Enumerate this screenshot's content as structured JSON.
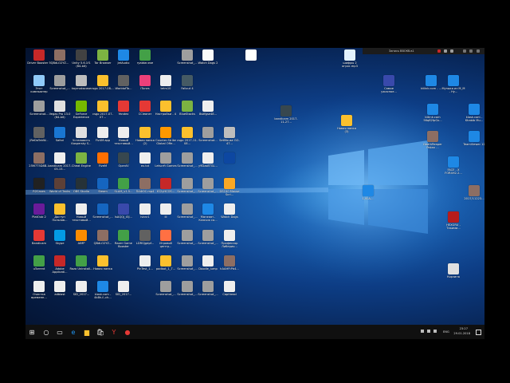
{
  "desktop_icons": [
    {
      "label": "Driver Booster 5",
      "color": "#c62828",
      "col": 0,
      "row": 0
    },
    {
      "label": "QBdLO2YZ...",
      "color": "#8d6e63",
      "col": 1,
      "row": 0
    },
    {
      "label": "Unity 5.6.1f1 (64-bit)",
      "color": "#424242",
      "col": 2,
      "row": 0
    },
    {
      "label": "Tor Browser",
      "color": "#7cb342",
      "col": 3,
      "row": 0
    },
    {
      "label": "JetAudio",
      "color": "#1e88e5",
      "col": 4,
      "row": 0
    },
    {
      "label": "ryabtar.exe",
      "color": "#43a047",
      "col": 5,
      "row": 0
    },
    {
      "label": "Screenshot_...",
      "color": "#9e9e9e",
      "col": 7,
      "row": 0
    },
    {
      "label": "Watch Dogs 2",
      "color": "#fafafa",
      "col": 8,
      "row": 0
    },
    {
      "label": "",
      "color": "#ffffff",
      "col": 10,
      "row": 0
    },
    {
      "label": "Этот компьютер",
      "color": "#90caf9",
      "col": 0,
      "row": 1
    },
    {
      "label": "Screenshot_...",
      "color": "#9e9e9e",
      "col": 1,
      "row": 1
    },
    {
      "label": "kaymakacase",
      "color": "#bdbdbd",
      "col": 2,
      "row": 1
    },
    {
      "label": "csgo 2017-08-...",
      "color": "#fbc02d",
      "col": 3,
      "row": 1
    },
    {
      "label": "WorldofTa...",
      "color": "#616161",
      "col": 4,
      "row": 1
    },
    {
      "label": "iTunes",
      "color": "#ec407a",
      "col": 5,
      "row": 1
    },
    {
      "label": "tetrs10",
      "color": "#eeeeee",
      "col": 6,
      "row": 1
    },
    {
      "label": "Fallout 4",
      "color": "#455a64",
      "col": 7,
      "row": 1
    },
    {
      "label": "Screenshot...",
      "color": "#9e9e9e",
      "col": 0,
      "row": 2
    },
    {
      "label": "Vegas Pro 13.0 (64-bit)",
      "color": "#e0e0e0",
      "col": 1,
      "row": 2
    },
    {
      "label": "GeForce Experience",
      "color": "#76b900",
      "col": 2,
      "row": 2
    },
    {
      "label": "csgo 2017-07-07...",
      "color": "#fbc02d",
      "col": 3,
      "row": 2
    },
    {
      "label": "Yandex",
      "color": "#e53935",
      "col": 4,
      "row": 2
    },
    {
      "label": "CCleaner",
      "color": "#e53935",
      "col": 5,
      "row": 2
    },
    {
      "label": "Настройки - 4",
      "color": "#fbc02d",
      "col": 6,
      "row": 2
    },
    {
      "label": "BlueStacks",
      "color": "#7cb342",
      "col": 7,
      "row": 2
    },
    {
      "label": "8sdfgse48...",
      "color": "#eeeeee",
      "col": 8,
      "row": 2
    },
    {
      "label": "jReDoTahW...",
      "color": "#616161",
      "col": 0,
      "row": 3
    },
    {
      "label": "Safari",
      "color": "#1976d2",
      "col": 1,
      "row": 3
    },
    {
      "label": "Установить Kaspersky S...",
      "color": "#e0e0e0",
      "col": 2,
      "row": 3
    },
    {
      "label": "Fiv4M.app",
      "color": "#eeeeee",
      "col": 3,
      "row": 3
    },
    {
      "label": "Новый текстовый...",
      "color": "#eeeeee",
      "col": 4,
      "row": 3
    },
    {
      "label": "Новая папка (2)",
      "color": "#fbc02d",
      "col": 5,
      "row": 3
    },
    {
      "label": "Counter-Strike Global Offe...",
      "color": "#ff9800",
      "col": 6,
      "row": 3
    },
    {
      "label": "csgo 2017-11-08...",
      "color": "#fbc02d",
      "col": 7,
      "row": 3
    },
    {
      "label": "Screenshot...",
      "color": "#9e9e9e",
      "col": 8,
      "row": 3
    },
    {
      "label": "SetMouse GO-47...",
      "color": "#bdbdbd",
      "col": 9,
      "row": 3
    },
    {
      "label": "25M7T5D8B...",
      "color": "#8d6e63",
      "col": 0,
      "row": 4
    },
    {
      "label": "bandicam 2017-05-15...",
      "color": "#eeeeee",
      "col": 1,
      "row": 4
    },
    {
      "label": "Cheat Engine",
      "color": "#7cb342",
      "col": 2,
      "row": 4
    },
    {
      "label": "FiveM",
      "color": "#ff6f00",
      "col": 3,
      "row": 4
    },
    {
      "label": "OpenIV",
      "color": "#37474f",
      "col": 4,
      "row": 4
    },
    {
      "label": "ex.txt",
      "color": "#eeeeee",
      "col": 5,
      "row": 4
    },
    {
      "label": "Letscrft Games",
      "color": "#9e9e9e",
      "col": 6,
      "row": 4
    },
    {
      "label": "Screenshot_...",
      "color": "#9e9e9e",
      "col": 7,
      "row": 4
    },
    {
      "label": "y9Dzo8TGL...",
      "color": "#eeeeee",
      "col": 8,
      "row": 4
    },
    {
      "label": "",
      "color": "#0d47a1",
      "col": 9,
      "row": 4
    },
    {
      "label": "R2Cases",
      "color": "#212121",
      "col": 0,
      "row": 5
    },
    {
      "label": "World of Tanks",
      "color": "#5d4037",
      "col": 1,
      "row": 5
    },
    {
      "label": "OBS Studio",
      "color": "#263238",
      "col": 2,
      "row": 5
    },
    {
      "label": "Steam",
      "color": "#1565c0",
      "col": 3,
      "row": 5
    },
    {
      "label": "SLAM_v1.5...",
      "color": "#43a047",
      "col": 4,
      "row": 5
    },
    {
      "label": "ПАФОС.mp4",
      "color": "#8d6e63",
      "col": 5,
      "row": 5
    },
    {
      "label": "fO2yHCOS...",
      "color": "#c62828",
      "col": 6,
      "row": 5
    },
    {
      "label": "Screenshot_...",
      "color": "#9e9e9e",
      "col": 7,
      "row": 5
    },
    {
      "label": "Screenshot_...",
      "color": "#9e9e9e",
      "col": 8,
      "row": 5
    },
    {
      "label": "DSC40 Mouse Scri...",
      "color": "#f9a825",
      "col": 9,
      "row": 5
    },
    {
      "label": "PlatOub 2",
      "color": "#6a1b9a",
      "col": 0,
      "row": 6
    },
    {
      "label": "Доступ Пользов...",
      "color": "#fbc02d",
      "col": 1,
      "row": 6
    },
    {
      "label": "Новый текстовый...",
      "color": "#eeeeee",
      "col": 2,
      "row": 6
    },
    {
      "label": "Screenshot_...",
      "color": "#1565c0",
      "col": 3,
      "row": 6
    },
    {
      "label": "lsAQQj_t3J...",
      "color": "#3949ab",
      "col": 4,
      "row": 6
    },
    {
      "label": "lvbnr1",
      "color": "#eeeeee",
      "col": 5,
      "row": 6
    },
    {
      "label": "lll",
      "color": "#eeeeee",
      "col": 6,
      "row": 6
    },
    {
      "label": "Screenshot_...",
      "color": "#9e9e9e",
      "col": 7,
      "row": 6
    },
    {
      "label": "Магазин - Ключик со...",
      "color": "#1e88e5",
      "col": 8,
      "row": 6
    },
    {
      "label": "Watch Dogs",
      "color": "#eeeeee",
      "col": 9,
      "row": 6
    },
    {
      "label": "Bandicam",
      "color": "#e53935",
      "col": 0,
      "row": 7
    },
    {
      "label": "Skype",
      "color": "#039be5",
      "col": 1,
      "row": 7
    },
    {
      "label": "AIMP",
      "color": "#fb8c00",
      "col": 2,
      "row": 7
    },
    {
      "label": "QBdLO2YZ...",
      "color": "#8d6e63",
      "col": 3,
      "row": 7
    },
    {
      "label": "Razer Game Booster",
      "color": "#43a047",
      "col": 4,
      "row": 7
    },
    {
      "label": "LDRGjgdpf...",
      "color": "#616161",
      "col": 5,
      "row": 7
    },
    {
      "label": "Игровой центр...",
      "color": "#ff7043",
      "col": 6,
      "row": 7
    },
    {
      "label": "Screenshot_...",
      "color": "#9e9e9e",
      "col": 7,
      "row": 7
    },
    {
      "label": "Screenshot_...",
      "color": "#9e9e9e",
      "col": 8,
      "row": 7
    },
    {
      "label": "Профессор Либерио...",
      "color": "#eeeeee",
      "col": 9,
      "row": 7
    },
    {
      "label": "uTorrent",
      "color": "#43a047",
      "col": 0,
      "row": 8
    },
    {
      "label": "Adobe Applicati...",
      "color": "#c62828",
      "col": 1,
      "row": 8
    },
    {
      "label": "Razo Uninstall...",
      "color": "#43a047",
      "col": 2,
      "row": 8
    },
    {
      "label": "Новая папка",
      "color": "#fbc02d",
      "col": 3,
      "row": 8
    },
    {
      "label": "PinTest_1...",
      "color": "#eeeeee",
      "col": 5,
      "row": 8
    },
    {
      "label": "podbot_1_7...",
      "color": "#fbc02d",
      "col": 6,
      "row": 8
    },
    {
      "label": "Screenshot_...",
      "color": "#9e9e9e",
      "col": 7,
      "row": 8
    },
    {
      "label": "Doodle_lump",
      "color": "#eeeeee",
      "col": 8,
      "row": 8
    },
    {
      "label": "hAAHFtPb4...",
      "color": "#8d6e63",
      "col": 9,
      "row": 8
    },
    {
      "label": "Очистка временн...",
      "color": "#eeeeee",
      "col": 0,
      "row": 9
    },
    {
      "label": "adblast",
      "color": "#eeeeee",
      "col": 1,
      "row": 9
    },
    {
      "label": "SID_2017...",
      "color": "#eeeeee",
      "col": 2,
      "row": 9
    },
    {
      "label": "kiosk.com - 4k8h-f--ch...",
      "color": "#1e88e5",
      "col": 3,
      "row": 9
    },
    {
      "label": "SID_2017...",
      "color": "#eeeeee",
      "col": 4,
      "row": 9
    },
    {
      "label": "Screenshot_...",
      "color": "#9e9e9e",
      "col": 6,
      "row": 9
    },
    {
      "label": "Screenshot_...",
      "color": "#9e9e9e",
      "col": 7,
      "row": 9
    },
    {
      "label": "Screenshot_...",
      "color": "#9e9e9e",
      "col": 8,
      "row": 9
    },
    {
      "label": "Capthead",
      "color": "#eeeeee",
      "col": 9,
      "row": 9
    }
  ],
  "floating_icons": [
    {
      "label": "шифры 2 огрос.mp3",
      "color": "#e3f2fd",
      "slot": "a"
    },
    {
      "label": "Самое ужасное...",
      "color": "#3949ab",
      "slot": "b"
    },
    {
      "label": "kiiiink.com - ...",
      "color": "#1e88e5",
      "slot": "c"
    },
    {
      "label": "Музыка из М_М - Ну...",
      "color": "#1e88e5",
      "slot": "d"
    },
    {
      "label": "bandicam 2017-11-27...",
      "color": "#37474f",
      "slot": "e"
    },
    {
      "label": "Новая папка (3)",
      "color": "#fbc02d",
      "slot": "f"
    },
    {
      "label": "kiiiink.com 56q82fpGx...",
      "color": "#1e88e5",
      "slot": "g"
    },
    {
      "label": "kiosk.com - Khabib Mu...",
      "color": "#1e88e5",
      "slot": "h"
    },
    {
      "label": "DeathReaper Pakan ...",
      "color": "#8d6e63",
      "slot": "i"
    },
    {
      "label": "TeamViewer 12",
      "color": "#1e88e5",
      "slot": "j"
    },
    {
      "label": "FACE - X FOR4H2-2...",
      "color": "#1e88e5",
      "slot": "k"
    },
    {
      "label": "2017/11223...",
      "color": "#8d6e63",
      "slot": "l"
    },
    {
      "label": "HEXGRU - Такими...",
      "color": "#b71c1c",
      "slot": "m"
    },
    {
      "label": "Корзина",
      "color": "#e0e0e0",
      "slot": "n"
    },
    {
      "label": "1-VLA-...",
      "color": "#1e88e5",
      "slot": "o"
    }
  ],
  "player": {
    "title": "Запись ВВОКб.в1"
  },
  "taskbar": {
    "items": [
      {
        "name": "start-button",
        "icon": "windows-icon",
        "glyph": "⊞",
        "color": "#ffffff"
      },
      {
        "name": "search-button",
        "icon": "search-icon",
        "glyph": "○",
        "color": "#ffffff"
      },
      {
        "name": "task-view-button",
        "icon": "task-view-icon",
        "glyph": "▭",
        "color": "#ffffff"
      },
      {
        "name": "edge-button",
        "icon": "edge-icon",
        "glyph": "e",
        "color": "#2196f3"
      },
      {
        "name": "explorer-button",
        "icon": "folder-icon",
        "glyph": "▆",
        "color": "#fbc02d"
      },
      {
        "name": "store-button",
        "icon": "store-icon",
        "glyph": "🛍",
        "color": "#ffffff"
      },
      {
        "name": "yandex-button",
        "icon": "yandex-icon",
        "glyph": "Y",
        "color": "#e53935"
      },
      {
        "name": "bandicam-button",
        "icon": "record-icon",
        "glyph": "●",
        "color": "#e53935"
      }
    ],
    "lang": "ENG",
    "time": "23:27",
    "date": "29.01.2018"
  }
}
